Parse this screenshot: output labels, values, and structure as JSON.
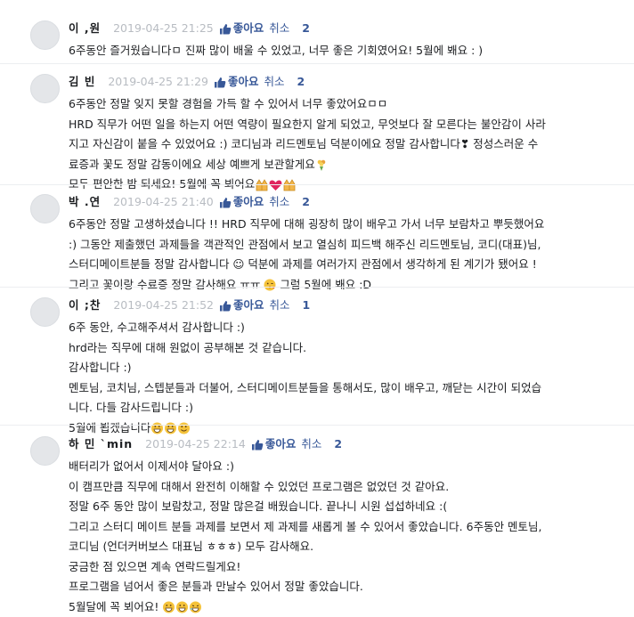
{
  "like_label": "좋아요",
  "cancel_label": "취소",
  "comments": [
    {
      "author": "이 ,원",
      "date": "2019-04-25 21:25",
      "likes": "2",
      "lines": [
        "6주동안 즐거웠습니다ㅁ 진짜 많이 배울 수 있었고, 너무 좋은 기회였어요! 5월에 봬요 : )"
      ]
    },
    {
      "author": "김  빈",
      "date": "2019-04-25 21:29",
      "likes": "2",
      "lines": [
        "6주동안 정말 잊지 못할 경험을 가득 할 수 있어서 너무 좋았어요ㅁㅁ",
        "HRD 직무가 어떤 일을 하는지 어떤 역량이 필요한지 알게 되었고, 무엇보다 잘 모른다는 불안감이 사라",
        "지고 자신감이 붙을 수 있었어요 :) 코디님과 리드멘토님 덕분이에요 정말 감사합니다❣ 정성스러운 수",
        "료증과 꽃도 정말 감동이에요 세상 예쁘게 보관할게요",
        "모두 편안한 밤 되세요! 5월에 꼭 뵈어요"
      ]
    },
    {
      "author": "박 .연",
      "date": "2019-04-25 21:40",
      "likes": "2",
      "lines": [
        "6주동안 정말 고생하셨습니다 !! HRD 직무에 대해 굉장히 많이 배우고 가서 너무 보람차고 뿌듯했어요",
        ":) 그동안 제출했던 과제들을 객관적인 관점에서 보고 열심히 피드백 해주신 리드멘토님, 코디(대표)님,",
        "스터디메이트분들 정말 감사합니다 ☺ 덕분에 과제를 여러가지 관점에서 생각하게 된 계기가 됐어요 !",
        "그리고 꽃이랑 수료증 정말 감사해요 ㅠㅠ",
        "그럼 5월에 봬요 :D"
      ]
    },
    {
      "author": "이 ;찬",
      "date": "2019-04-25 21:52",
      "likes": "1",
      "lines": [
        "6주 동안, 수고해주셔서 감사합니다 :)",
        "hrd라는 직무에 대해 원없이 공부해본 것  같습니다.",
        "감사합니다 :)",
        "멘토님, 코치님, 스텝분들과 더불어, 스터디메이트분들을 통해서도, 많이 배우고, 깨닫는 시간이 되었습",
        "니다. 다들 감사드립니다 :)",
        "5월에 뵙겠습니다"
      ]
    },
    {
      "author": "하  민 `min",
      "date": "2019-04-25 22:14",
      "likes": "2",
      "lines": [
        "배터리가 없어서 이제서야 달아요 :)",
        "이 캠프만큼 직무에 대해서 완전히 이해할 수 있었던 프로그램은 없었던 것 같아요.",
        "정말 6주 동안 많이 보람찼고, 정말 많은걸 배웠습니다. 끝나니 시원 섭섭하네요 :(",
        "그리고 스터디 메이트 분들 과제를 보면서 제 과제를 새롭게 볼 수 있어서 좋았습니다. 6주동안 멘토님,",
        "코디님 (언더커버보스  대표님 ㅎㅎㅎ) 모두 감사해요.",
        "궁금한 점 있으면 계속 연락드릴게요!",
        "프로그램을 넘어서 좋은 분들과 만날수 있어서 정말 좋았습니다.",
        "5월달에 꼭 뵈어요!"
      ]
    }
  ]
}
